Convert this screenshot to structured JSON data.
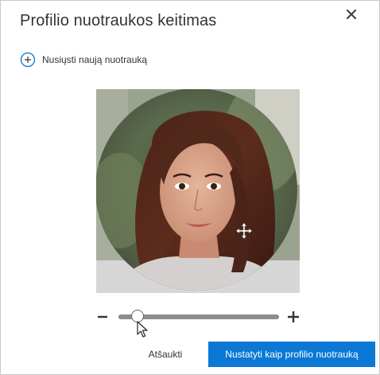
{
  "dialog": {
    "title": "Profilio nuotraukos keitimas",
    "close_icon": "close-icon"
  },
  "upload": {
    "icon": "plus-circle-icon",
    "label": "Nusiųsti naują nuotrauką"
  },
  "editor": {
    "photo": "profile-photo",
    "move_icon": "move-icon"
  },
  "zoom": {
    "minus_icon": "minus-icon",
    "plus_icon": "plus-icon",
    "level": 0.12
  },
  "actions": {
    "cancel_label": "Atšaukti",
    "save_label": "Nustatyti kaip profilio nuotrauką"
  },
  "colors": {
    "primary": "#0a78d4",
    "text": "#333333"
  }
}
